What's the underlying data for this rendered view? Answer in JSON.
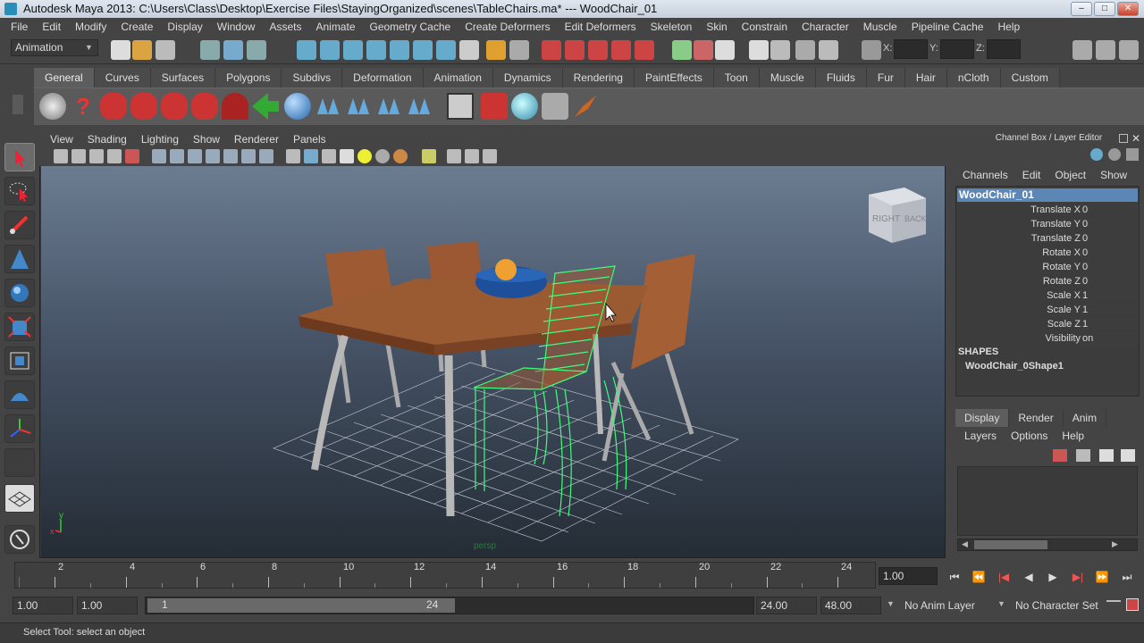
{
  "window": {
    "title": "Autodesk Maya 2013: C:\\Users\\Class\\Desktop\\Exercise Files\\StayingOrganized\\scenes\\TableChairs.ma*   ---   WoodChair_01",
    "min": "–",
    "max": "□",
    "close": "✕"
  },
  "menubar": [
    "File",
    "Edit",
    "Modify",
    "Create",
    "Display",
    "Window",
    "Assets",
    "Animate",
    "Geometry Cache",
    "Create Deformers",
    "Edit Deformers",
    "Skeleton",
    "Skin",
    "Constrain",
    "Character",
    "Muscle",
    "Pipeline Cache",
    "Help"
  ],
  "statusline": {
    "menuset": "Animation",
    "x_label": "X:",
    "y_label": "Y:",
    "z_label": "Z:"
  },
  "shelf_tabs": [
    "General",
    "Curves",
    "Surfaces",
    "Polygons",
    "Subdivs",
    "Deformation",
    "Animation",
    "Dynamics",
    "Rendering",
    "PaintEffects",
    "Toon",
    "Muscle",
    "Fluids",
    "Fur",
    "Hair",
    "nCloth",
    "Custom"
  ],
  "viewport": {
    "menu": [
      "View",
      "Shading",
      "Lighting",
      "Show",
      "Renderer",
      "Panels"
    ],
    "camera_label": "persp",
    "viewcube_right": "RIGHT",
    "viewcube_back": "BACK",
    "axis_y": "y",
    "axis_x": "x"
  },
  "channel_box": {
    "header": "Channel Box / Layer Editor",
    "menu": [
      "Channels",
      "Edit",
      "Object",
      "Show"
    ],
    "object": "WoodChair_01",
    "attrs": [
      {
        "label": "Translate X",
        "value": "0"
      },
      {
        "label": "Translate Y",
        "value": "0"
      },
      {
        "label": "Translate Z",
        "value": "0"
      },
      {
        "label": "Rotate X",
        "value": "0"
      },
      {
        "label": "Rotate Y",
        "value": "0"
      },
      {
        "label": "Rotate Z",
        "value": "0"
      },
      {
        "label": "Scale X",
        "value": "1"
      },
      {
        "label": "Scale Y",
        "value": "1"
      },
      {
        "label": "Scale Z",
        "value": "1"
      },
      {
        "label": "Visibility",
        "value": "on"
      }
    ],
    "shapes_header": "SHAPES",
    "shape_name": "WoodChair_0Shape1"
  },
  "layer_editor": {
    "tabs": [
      "Display",
      "Render",
      "Anim"
    ],
    "menu": [
      "Layers",
      "Options",
      "Help"
    ]
  },
  "timeline": {
    "ticks": [
      "2",
      "4",
      "6",
      "8",
      "10",
      "12",
      "14",
      "16",
      "18",
      "20",
      "22",
      "24"
    ],
    "current_frame": "1.00"
  },
  "playback_buttons": [
    "⏮",
    "⏪",
    "|◀",
    "◀",
    "▶",
    "▶|",
    "⏩",
    "⏭"
  ],
  "range": {
    "start": "1.00",
    "playback_start": "1.00",
    "slider_start": "1",
    "slider_end": "24",
    "playback_end": "24.00",
    "end": "48.00",
    "anim_layer": "No Anim Layer",
    "character_set": "No Character Set"
  },
  "help_line": "Select Tool: select an object",
  "colors": {
    "selection": "#5b86b5",
    "wireframe_highlight": "#3dff7a",
    "wood": "#9a5a32"
  }
}
